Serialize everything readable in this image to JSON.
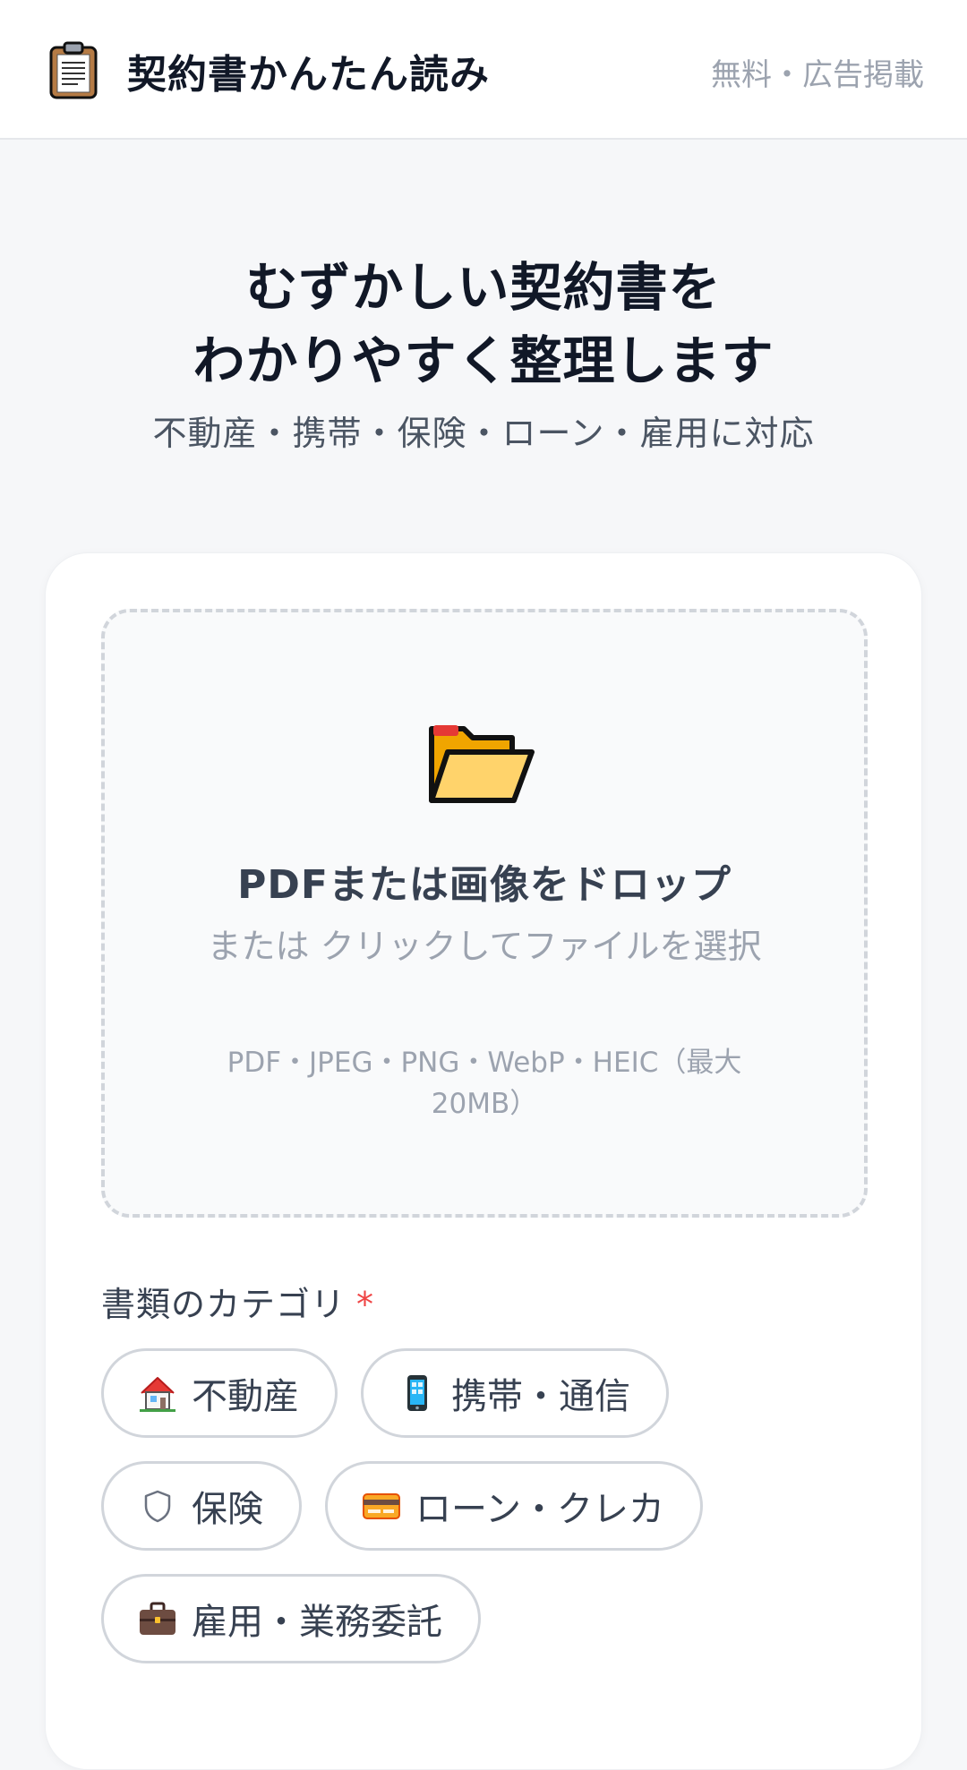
{
  "header": {
    "app_title": "契約書かんたん読み",
    "note": "無料・広告掲載",
    "icon": "clipboard-icon"
  },
  "hero": {
    "title_line1": "むずかしい契約書を",
    "title_line2": "わかりやすく整理します",
    "subtitle": "不動産・携帯・保険・ローン・雇用に対応"
  },
  "upload": {
    "icon": "folder-icon",
    "title": "PDFまたは画像をドロップ",
    "hint": "または クリックしてファイルを選択",
    "formats": "PDF・JPEG・PNG・WebP・HEIC（最大20MB）"
  },
  "category": {
    "label": "書類のカテゴリ",
    "required_mark": "*",
    "options": [
      {
        "label": "不動産",
        "icon": "house-icon"
      },
      {
        "label": "携帯・通信",
        "icon": "mobile-phone-icon"
      },
      {
        "label": "保険",
        "icon": "shield-icon"
      },
      {
        "label": "ローン・クレカ",
        "icon": "credit-card-icon"
      },
      {
        "label": "雇用・業務委託",
        "icon": "briefcase-icon"
      }
    ]
  },
  "colors": {
    "background": "#f6f7f9",
    "accent_required": "#ef4444",
    "text_primary": "#111827",
    "text_muted": "#9ca3af",
    "border": "#d1d5db"
  }
}
